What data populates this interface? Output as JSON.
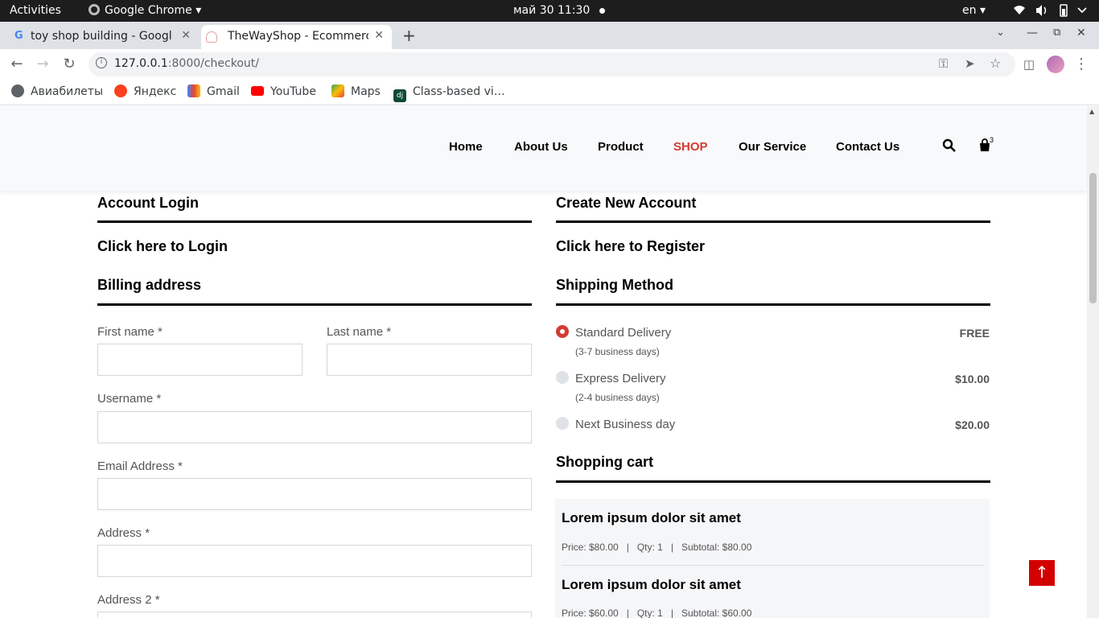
{
  "os": {
    "activities": "Activities",
    "app_name": "Google Chrome",
    "datetime": "май 30  11:30",
    "lang": "en"
  },
  "tabs": [
    {
      "label": "toy shop building - Google",
      "active": false
    },
    {
      "label": "TheWayShop - Ecommerce",
      "active": true
    }
  ],
  "toolbar": {
    "url_host": "127.0.0.1",
    "url_path": ":8000/checkout/"
  },
  "bookmarks": [
    {
      "label": "Авиабилеты",
      "icon": "globe-icon"
    },
    {
      "label": "Яндекс",
      "icon": "yandex-icon"
    },
    {
      "label": "Gmail",
      "icon": "gmail-icon"
    },
    {
      "label": "YouTube",
      "icon": "youtube-icon"
    },
    {
      "label": "Maps",
      "icon": "maps-icon"
    },
    {
      "label": "Class-based vi…",
      "icon": "django-icon"
    }
  ],
  "nav": {
    "items": [
      "Home",
      "About Us",
      "Product",
      "SHOP",
      "Our Service",
      "Contact Us"
    ],
    "active": "SHOP",
    "cart_count": "3"
  },
  "account": {
    "login_title": "Account Login",
    "login_link": "Click here to Login",
    "register_title": "Create New Account",
    "register_link": "Click here to Register"
  },
  "billing": {
    "title": "Billing address",
    "first_name": "First name *",
    "last_name": "Last name *",
    "username": "Username *",
    "email": "Email Address *",
    "address": "Address *",
    "address2": "Address 2 *"
  },
  "shipping": {
    "title": "Shipping Method",
    "options": [
      {
        "name": "Standard Delivery",
        "note": "(3-7 business days)",
        "price": "FREE",
        "selected": true
      },
      {
        "name": "Express Delivery",
        "note": "(2-4 business days)",
        "price": "$10.00",
        "selected": false
      },
      {
        "name": "Next Business day",
        "note": "",
        "price": "$20.00",
        "selected": false
      }
    ]
  },
  "cart": {
    "title": "Shopping cart",
    "items": [
      {
        "name": "Lorem ipsum dolor sit amet",
        "price": "Price: $80.00",
        "qty": "Qty: 1",
        "subtotal": "Subtotal: $80.00"
      },
      {
        "name": "Lorem ipsum dolor sit amet",
        "price": "Price: $60.00",
        "qty": "Qty: 1",
        "subtotal": "Subtotal: $60.00"
      }
    ]
  },
  "colors": {
    "accent": "#d33b33",
    "to_top": "#d30000"
  }
}
